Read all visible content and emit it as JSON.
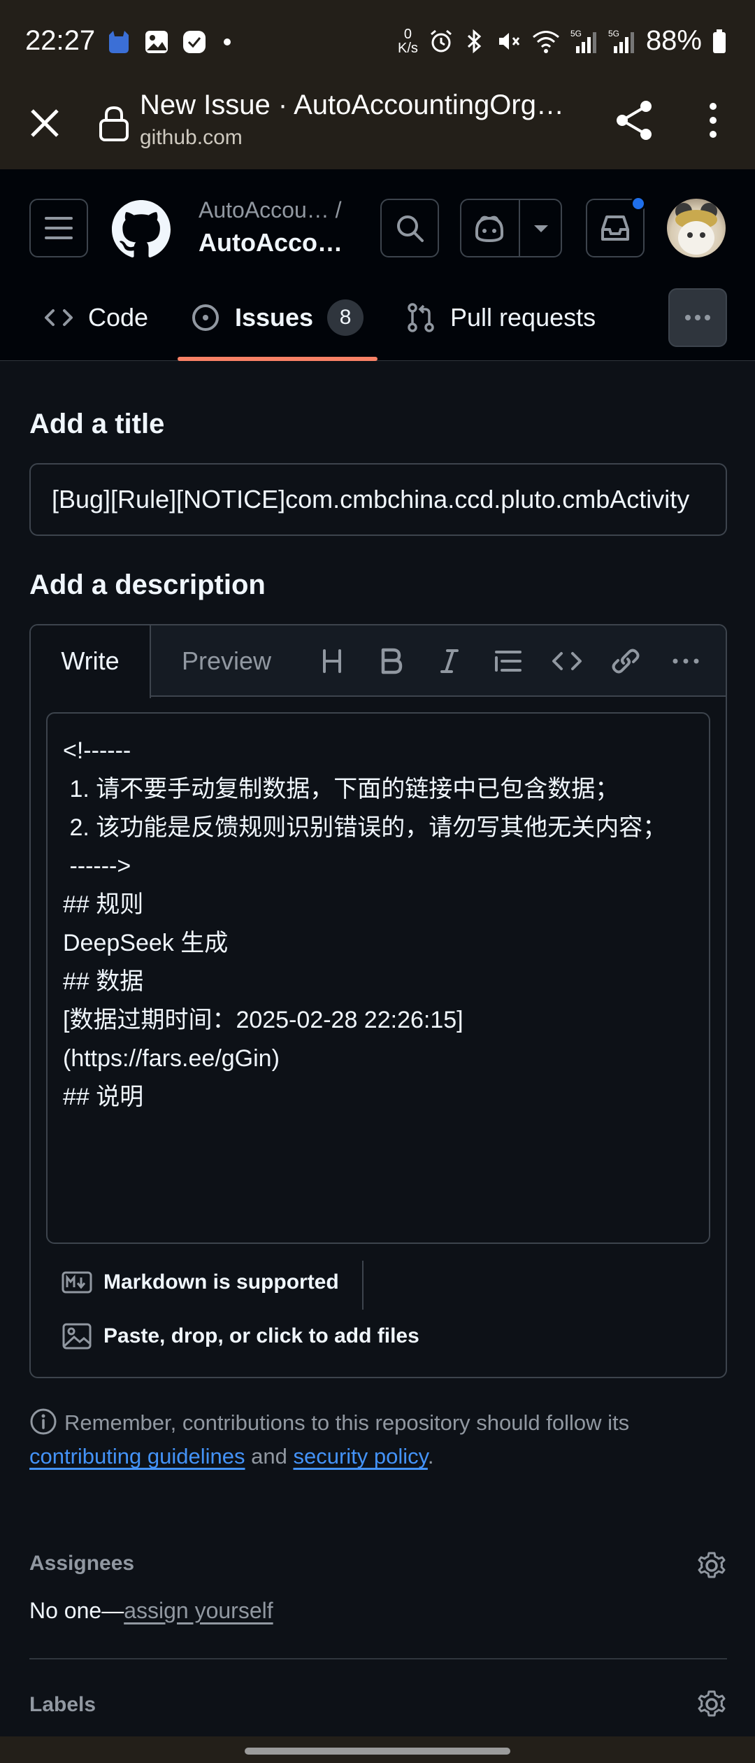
{
  "status_bar": {
    "time": "22:27",
    "net_speed_value": "0",
    "net_speed_unit": "K/s",
    "battery": "88%"
  },
  "browser": {
    "page_title": "New Issue · AutoAccountingOrg…",
    "url": "github.com"
  },
  "header": {
    "repo_owner": "AutoAccou…  /",
    "repo_name": "AutoAcco…"
  },
  "tabs": {
    "code": "Code",
    "issues": "Issues",
    "issues_count": "8",
    "pulls": "Pull requests"
  },
  "form": {
    "title_heading": "Add a title",
    "title_value": "[Bug][Rule][NOTICE]com.cmbchina.ccd.pluto.cmbActivity",
    "description_heading": "Add a description",
    "tab_write": "Write",
    "tab_preview": "Preview",
    "toolbar_heading": "H",
    "toolbar_bold": "B",
    "toolbar_italic": "I",
    "description_value": "<!------\n 1. 请不要手动复制数据，下面的链接中已包含数据；\n 2. 该功能是反馈规则识别错误的，请勿写其他无关内容；\n ------>\n## 规则\nDeepSeek 生成\n## 数据\n[数据过期时间：2025-02-28 22:26:15]\n(https://fars.ee/gGin)\n## 说明",
    "markdown_note": "Markdown is supported",
    "files_note": "Paste, drop, or click to add files"
  },
  "notice": {
    "text_before": "Remember, contributions to this repository should follow its",
    "link_contributing": "contributing guidelines",
    "text_and": "and",
    "link_security": "security policy",
    "text_end": "."
  },
  "sidebar": {
    "assignees_label": "Assignees",
    "assignees_none": "No one—",
    "assign_yourself": "assign yourself",
    "labels_label": "Labels"
  },
  "colors": {
    "background": "#0d1117",
    "header_bg": "#010409",
    "accent_underline": "#f78166",
    "link": "#4493f8",
    "notification": "#1f6feb"
  },
  "icons": [
    "close-icon",
    "lock-icon",
    "share-icon",
    "more-vertical-icon",
    "hamburger-icon",
    "github-logo-icon",
    "search-icon",
    "copilot-icon",
    "chevron-down-icon",
    "inbox-icon",
    "code-icon",
    "issue-icon",
    "pull-request-icon",
    "more-horizontal-icon",
    "heading-icon",
    "bold-icon",
    "italic-icon",
    "list-icon",
    "code-icon",
    "link-icon",
    "markdown-icon",
    "image-icon",
    "info-icon",
    "gear-icon"
  ]
}
